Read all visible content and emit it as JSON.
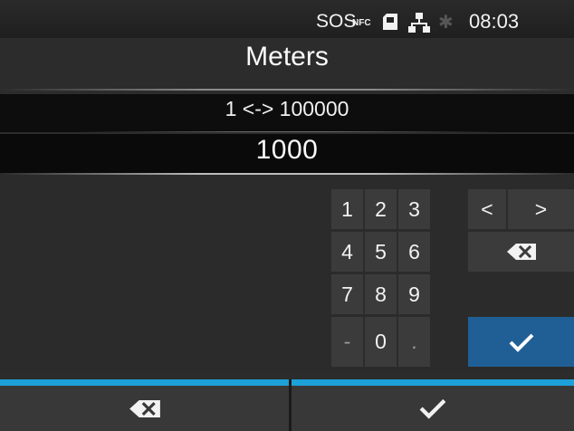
{
  "status": {
    "sos": "SOS",
    "nfc": "NFC",
    "time": "08:03",
    "icons": [
      "nfc-icon",
      "sd-card-icon",
      "network-icon",
      "bluetooth-icon"
    ]
  },
  "header": {
    "title": "Meters"
  },
  "input": {
    "range": "1 <-> 100000",
    "value": "1000"
  },
  "keypad": {
    "keys": [
      "1",
      "2",
      "3",
      "4",
      "5",
      "6",
      "7",
      "8",
      "9",
      "-",
      "0",
      "."
    ],
    "left": "<",
    "right": ">"
  },
  "colors": {
    "accent": "#1da1d8",
    "ok": "#1f5f95",
    "key": "#3b3b3b",
    "background": "#2b2b2b"
  }
}
